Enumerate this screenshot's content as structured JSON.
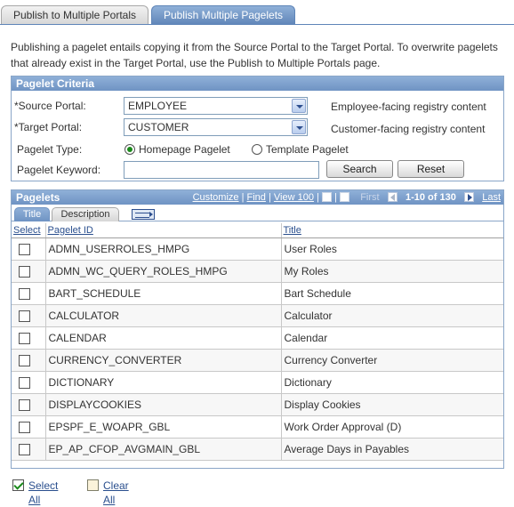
{
  "tabs": [
    {
      "label": "Publish to Multiple Portals",
      "active": false
    },
    {
      "label": "Publish Multiple Pagelets",
      "active": true
    }
  ],
  "intro": "Publishing a pagelet entails copying it from the Source Portal to the Target Portal. To overwrite pagelets that already exist in the Target Portal, use the Publish to Multiple Portals page.",
  "criteria": {
    "header": "Pagelet Criteria",
    "source_label": "*Source Portal:",
    "source_value": "EMPLOYEE",
    "source_desc": "Employee-facing registry content",
    "target_label": "*Target Portal:",
    "target_value": "CUSTOMER",
    "target_desc": "Customer-facing registry content",
    "type_label": "Pagelet Type:",
    "type_homepage": "Homepage Pagelet",
    "type_template": "Template Pagelet",
    "type_selected": "Homepage Pagelet",
    "keyword_label": "Pagelet Keyword:",
    "keyword_value": "",
    "search_button": "Search",
    "reset_button": "Reset"
  },
  "grid": {
    "header": "Pagelets",
    "nav": {
      "customize": "Customize",
      "find": "Find",
      "view": "View 100",
      "first": "First",
      "range": "1-10 of 130",
      "last": "Last"
    },
    "tabs": [
      {
        "label": "Title",
        "active": true
      },
      {
        "label": "Description",
        "active": false
      }
    ],
    "columns": [
      "Select",
      "Pagelet ID",
      "Title"
    ],
    "rows": [
      {
        "id": "ADMN_USERROLES_HMPG",
        "title": "User Roles"
      },
      {
        "id": "ADMN_WC_QUERY_ROLES_HMPG",
        "title": "My Roles"
      },
      {
        "id": "BART_SCHEDULE",
        "title": "Bart Schedule"
      },
      {
        "id": "CALCULATOR",
        "title": "Calculator"
      },
      {
        "id": "CALENDAR",
        "title": "Calendar"
      },
      {
        "id": "CURRENCY_CONVERTER",
        "title": "Currency Converter"
      },
      {
        "id": "DICTIONARY",
        "title": "Dictionary"
      },
      {
        "id": "DISPLAYCOOKIES",
        "title": "Display Cookies"
      },
      {
        "id": "EPSPF_E_WOAPR_GBL",
        "title": "Work Order Approval (D)"
      },
      {
        "id": "EP_AP_CFOP_AVGMAIN_GBL",
        "title": "Average Days in Payables"
      }
    ]
  },
  "footer": {
    "select_all": "Select All",
    "clear_all": "Clear All"
  }
}
